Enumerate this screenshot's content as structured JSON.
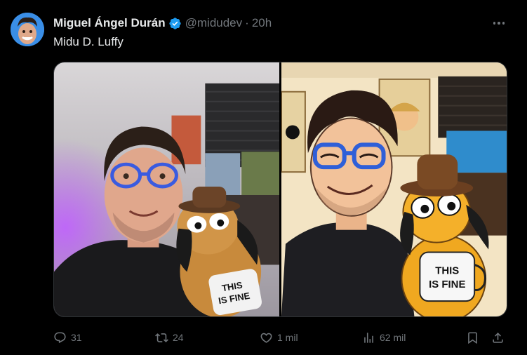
{
  "tweet": {
    "author_name": "Miguel Ángel Durán",
    "handle": "@midudev",
    "separator": "·",
    "time": "20h",
    "text": "Midu D. Luffy",
    "avatar_icon": "user-avatar",
    "verified_icon": "verified-badge-icon",
    "more_icon": "more-options-icon"
  },
  "media": {
    "images": [
      {
        "name": "selfie-with-this-is-fine-dog-plush",
        "mug_text": [
          "THIS",
          "IS FINE"
        ]
      },
      {
        "name": "anime-style-version-with-this-is-fine-dog",
        "mug_text": [
          "THIS",
          "IS FINE"
        ]
      }
    ]
  },
  "actions": {
    "reply": {
      "icon": "reply-icon",
      "count": "31"
    },
    "repost": {
      "icon": "repost-icon",
      "count": "24"
    },
    "like": {
      "icon": "like-icon",
      "count": "1 mil"
    },
    "views": {
      "icon": "views-icon",
      "count": "62 mil"
    },
    "bookmark": {
      "icon": "bookmark-icon"
    },
    "share": {
      "icon": "share-icon"
    }
  },
  "colors": {
    "background": "#000000",
    "text_primary": "#e7e9ea",
    "text_secondary": "#71767b",
    "verified": "#1d9bf0",
    "border": "#2f3336"
  }
}
